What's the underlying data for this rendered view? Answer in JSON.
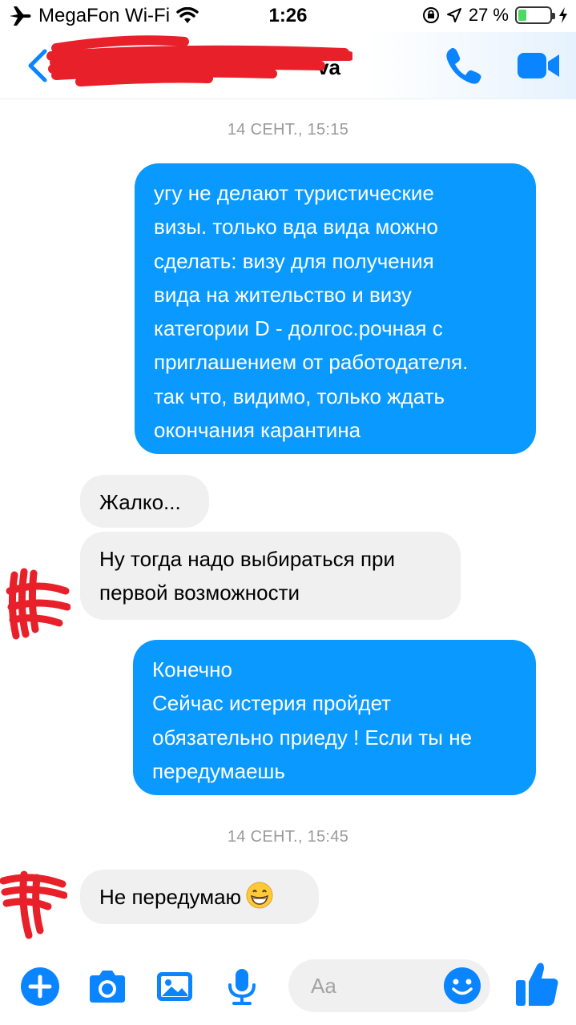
{
  "status_bar": {
    "carrier": "MegaFon Wi-Fi",
    "time": "1:26",
    "battery_percent": "27 %",
    "battery_level": 0.27
  },
  "header": {
    "contact_name_visible": "va",
    "icons": {
      "back": "chevron-left-icon",
      "call": "phone-icon",
      "video": "video-camera-icon"
    },
    "accent_color": "#0a84ff"
  },
  "messages": [
    {
      "type": "timestamp",
      "text": "14 СЕНТ., 15:15"
    },
    {
      "type": "outgoing",
      "lines": [
        "угу не делают туристические",
        "визы. только вда вида можно",
        "сделать: визу для получения",
        "вида на жительство и визу",
        "категории D - долгос.рочная с",
        "приглашением от работодателя.",
        "так что, видимо, только ждать",
        "окончания карантина"
      ]
    },
    {
      "type": "incoming",
      "lines": [
        "Жалко..."
      ]
    },
    {
      "type": "incoming",
      "lines": [
        "Ну тогда надо выбираться при",
        "первой возможности"
      ]
    },
    {
      "type": "outgoing",
      "lines": [
        "Конечно",
        "Сейчас истерия пройдет",
        "обязательно приеду ! Если ты не",
        "передумаешь"
      ]
    },
    {
      "type": "timestamp",
      "text": "14 СЕНТ., 15:45"
    },
    {
      "type": "incoming",
      "lines": [
        "Не передумаю"
      ],
      "emoji": "grinning-face-emoji"
    }
  ],
  "composer": {
    "placeholder": "Aa",
    "icons": [
      "plus-icon",
      "camera-icon",
      "image-icon",
      "microphone-icon",
      "smiley-icon",
      "thumbs-up-icon"
    ]
  },
  "colors": {
    "outgoing_bubble": "#0a99ff",
    "incoming_bubble": "#f0f0f0",
    "accent": "#0a84ff",
    "redaction": "#e8202a"
  }
}
